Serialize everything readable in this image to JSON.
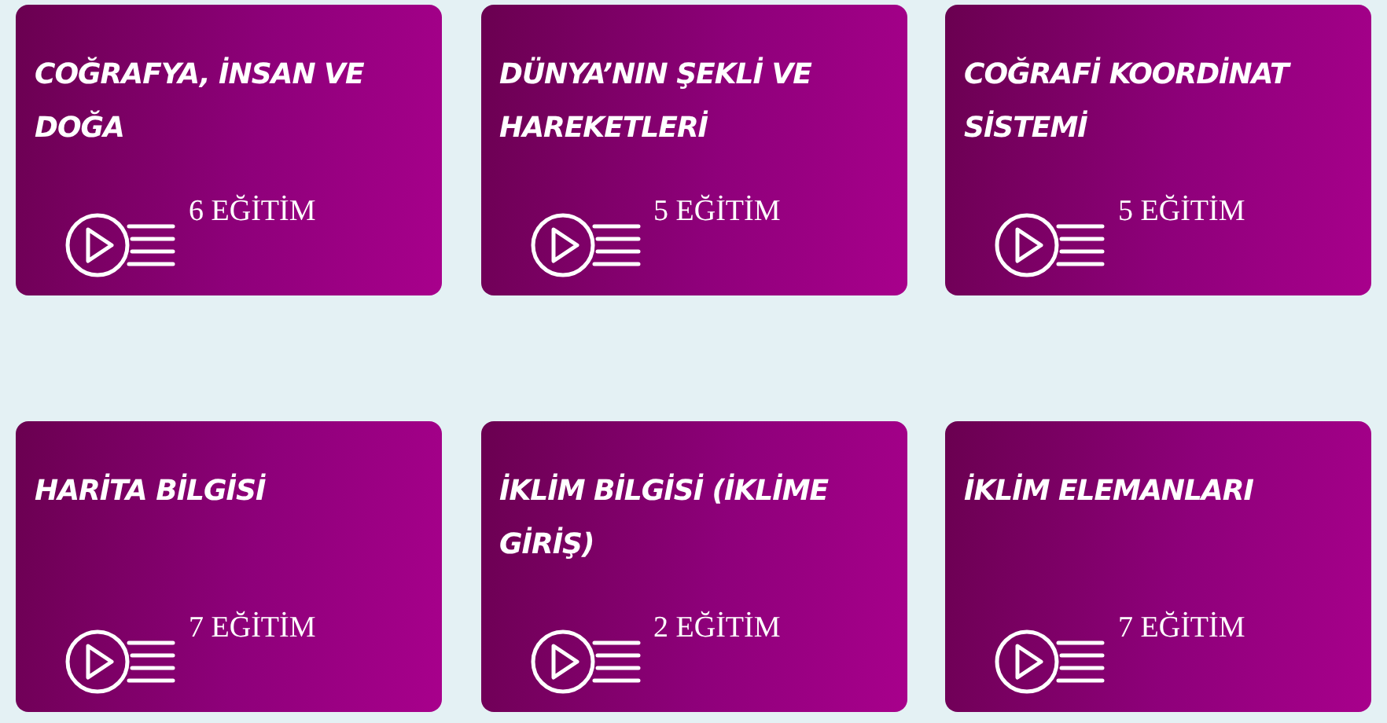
{
  "courses": [
    {
      "title": "COĞRAFYA, İNSAN VE DOĞA",
      "count": "6 EĞİTİM"
    },
    {
      "title": "DÜNYA’NIN ŞEKLİ VE HAREKETLERİ",
      "count": "5 EĞİTİM"
    },
    {
      "title": "COĞRAFİ KOORDİNAT SİSTEMİ",
      "count": "5 EĞİTİM"
    },
    {
      "title": "HARİTA BİLGİSİ",
      "count": "7 EĞİTİM"
    },
    {
      "title": "İKLİM BİLGİSİ (İKLİME GİRİŞ)",
      "count": "2 EĞİTİM"
    },
    {
      "title": "İKLİM ELEMANLARI",
      "count": "7 EĞİTİM"
    }
  ]
}
